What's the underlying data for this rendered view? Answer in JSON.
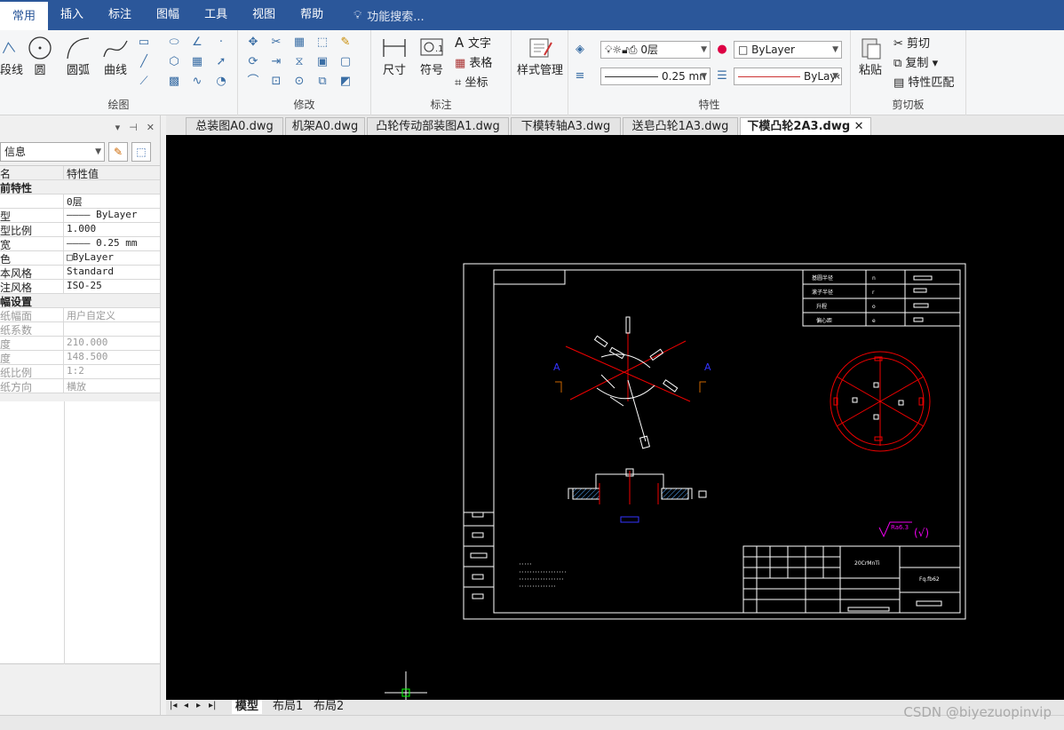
{
  "menu": {
    "items": [
      "常用",
      "插入",
      "标注",
      "图幅",
      "工具",
      "视图",
      "帮助"
    ],
    "active": "常用",
    "search_placeholder": "功能搜索..."
  },
  "ribbon": {
    "draw": {
      "label": "绘图",
      "line_label": "段线",
      "circle_label": "圆",
      "arc_label": "圆弧",
      "curve_label": "曲线"
    },
    "modify": {
      "label": "修改"
    },
    "annotate": {
      "label": "标注",
      "dim_label": "尺寸",
      "symbol_label": "符号",
      "text_label": "文字",
      "table_label": "表格",
      "coord_label": "坐标"
    },
    "style": {
      "label": "样式管理"
    },
    "properties": {
      "label": "特性",
      "layer_value": "0层",
      "color_value": "ByLayer",
      "lineweight_value": "0.25 mn",
      "linetype_value": "ByLay‹"
    },
    "clipboard": {
      "label": "剪切板",
      "paste_label": "粘贴",
      "cut_label": "剪切",
      "copy_label": "复制",
      "match_label": "特性匹配"
    }
  },
  "panel": {
    "dropdown_value": "信息",
    "header_name": "名",
    "header_value": "特性值",
    "rows": [
      {
        "name": "前特性",
        "value": "",
        "type": "cat"
      },
      {
        "name": "",
        "value": "0层",
        "type": "row"
      },
      {
        "name": "型",
        "value": "———— ByLayer",
        "type": "row"
      },
      {
        "name": "型比例",
        "value": "1.000",
        "type": "row"
      },
      {
        "name": "宽",
        "value": "———— 0.25 mm",
        "type": "row"
      },
      {
        "name": "色",
        "value": "□ByLayer",
        "type": "row"
      },
      {
        "name": "本风格",
        "value": "Standard",
        "type": "row"
      },
      {
        "name": "注风格",
        "value": "ISO-25",
        "type": "row"
      },
      {
        "name": "幅设置",
        "value": "",
        "type": "cat"
      },
      {
        "name": "纸幅面",
        "value": "用户自定义",
        "type": "dim"
      },
      {
        "name": "纸系数",
        "value": "",
        "type": "dim"
      },
      {
        "name": "度",
        "value": "210.000",
        "type": "dim"
      },
      {
        "name": "度",
        "value": "148.500",
        "type": "dim"
      },
      {
        "name": "纸比例",
        "value": "1:2",
        "type": "dim"
      },
      {
        "name": "纸方向",
        "value": "横放",
        "type": "dim"
      }
    ]
  },
  "doc_tabs": [
    "总装图A0.dwg",
    "机架A0.dwg",
    "凸轮传动部装图A1.dwg",
    "下模转轴A3.dwg",
    "送皂凸轮1A3.dwg",
    "下模凸轮2A3.dwg"
  ],
  "active_doc": "下模凸轮2A3.dwg",
  "drawing": {
    "table_labels": [
      "基圆半径",
      "滚子半径",
      "升程",
      "偏心距"
    ],
    "table_symbols": [
      "n",
      "r",
      "o",
      "e"
    ],
    "section_mark": "A",
    "roughness": "Ra6.3",
    "roughness_suffix": "(√)",
    "material": "20CrMnTi",
    "title_text": "Fq.fb62"
  },
  "layout_tabs": [
    "模型",
    "布局1",
    "布局2"
  ],
  "watermark": "CSDN @biyezuopinvip"
}
